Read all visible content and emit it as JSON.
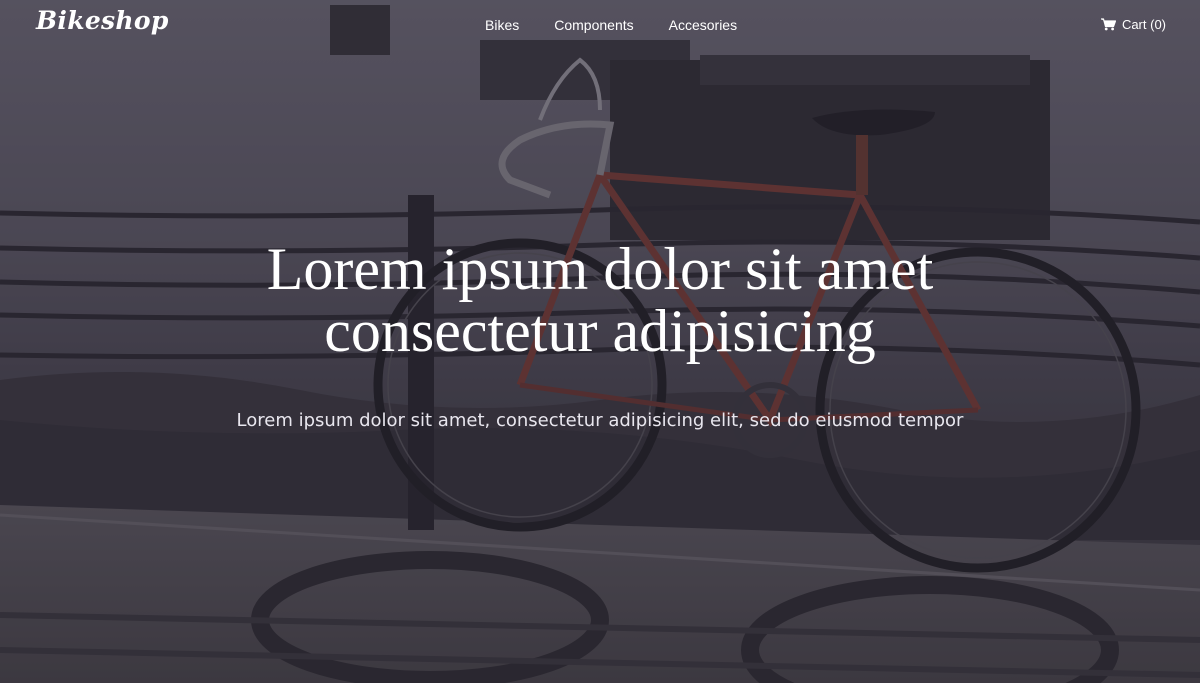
{
  "brand": {
    "name": "Bikeshop"
  },
  "nav": {
    "items": [
      {
        "label": "Bikes"
      },
      {
        "label": "Components"
      },
      {
        "label": "Accesories"
      }
    ]
  },
  "cart": {
    "label": "Cart (0)",
    "icon": "shopping-cart-icon"
  },
  "hero": {
    "title_line1": "Lorem ipsum dolor sit amet",
    "title_line2": "consectetur adipisicing",
    "subtitle": "Lorem ipsum dolor sit amet, consectetur adipisicing elit, sed do eiusmod tempor",
    "background_image": "bicycle-by-waterfront"
  },
  "colors": {
    "text": "#ffffff",
    "overlay": "#2a2830"
  }
}
